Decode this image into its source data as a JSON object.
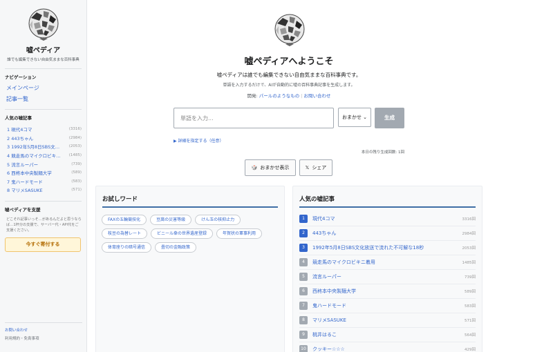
{
  "sidebar": {
    "title": "嘘ペディア",
    "tagline": "誰でも編集できない自由気ままな百科事典",
    "nav_head": "ナビゲーション",
    "nav": [
      {
        "label": "メインページ"
      },
      {
        "label": "記事一覧"
      }
    ],
    "popular_head": "人気の嘘記事",
    "popular": [
      {
        "title": "1 現代4コマ",
        "count": "(3316)"
      },
      {
        "title": "2 443ちゃん",
        "count": "(2984)"
      },
      {
        "title": "3 1992年5月8日SBS文…",
        "count": "(2053)"
      },
      {
        "title": "4 競走馬のマイクロビキニ…",
        "count": "(1485)"
      },
      {
        "title": "5 流言ルーパー",
        "count": "(739)"
      },
      {
        "title": "6 西柊本中央製麺大学",
        "count": "(589)"
      },
      {
        "title": "7 鬼ハードモード",
        "count": "(583)"
      },
      {
        "title": "8 マリメSASUKE",
        "count": "(571)"
      }
    ],
    "support_head": "嘘ペディアを支援",
    "support_desc": "どこそれ記事いっそ…があるんだよと思うならば…1杯分の支援で、サーバー代・API代をご支援ください。",
    "donate_label": "今すぐ寄付する",
    "footer_contact": "お問い合わせ",
    "footer_terms": "利用規約・免責事項"
  },
  "main": {
    "title": "嘘ペディアへようこそ",
    "desc": "嘘ペディアは誰でも編集できない自由気ままな百科事典です。",
    "sub": "単語を入力するだけで、AIが自動的に嘘の百科事典記事を生成します。",
    "dev_label": "開発:",
    "dev_link": "パールのようなもの",
    "contact_link": "お問い合わせ",
    "input_placeholder": "単語を入力...",
    "mode_value": "おまかせ",
    "generate_label": "生成",
    "details_label": "▶ 詳細を指定する（任意）",
    "remaining_label": "本日の残り生成回数: 1回",
    "random_label": "おまかせ表示",
    "share_label": "シェア"
  },
  "try_words": {
    "heading": "お試しワード",
    "tags": [
      "FAXの五輪競技化",
      "豆腐の災害等級",
      "けん玉の核抑止力",
      "枝豆の為替レート",
      "ビニール傘の世界遺産登録",
      "年賀状の軍事利用",
      "体育座りの暗号通信",
      "畳切の金融政策"
    ]
  },
  "popular_articles": {
    "heading": "人気の嘘記事",
    "items": [
      {
        "rank": "1",
        "title": "現代4コマ",
        "count": "3316回"
      },
      {
        "rank": "2",
        "title": "443ちゃん",
        "count": "2984回"
      },
      {
        "rank": "3",
        "title": "1992年5月8日SBS文化放送で流れた不可解な18秒",
        "count": "2053回"
      },
      {
        "rank": "4",
        "title": "競走馬のマイクロビキニ着用",
        "count": "1485回"
      },
      {
        "rank": "5",
        "title": "流言ルーパー",
        "count": "739回"
      },
      {
        "rank": "6",
        "title": "西柊本中央製麺大学",
        "count": "589回"
      },
      {
        "rank": "7",
        "title": "鬼ハードモード",
        "count": "583回"
      },
      {
        "rank": "8",
        "title": "マリメSASUKE",
        "count": "571回"
      },
      {
        "rank": "9",
        "title": "桃井はるこ",
        "count": "564回"
      },
      {
        "rank": "10",
        "title": "クッキー☆☆☆",
        "count": "429回"
      }
    ]
  }
}
